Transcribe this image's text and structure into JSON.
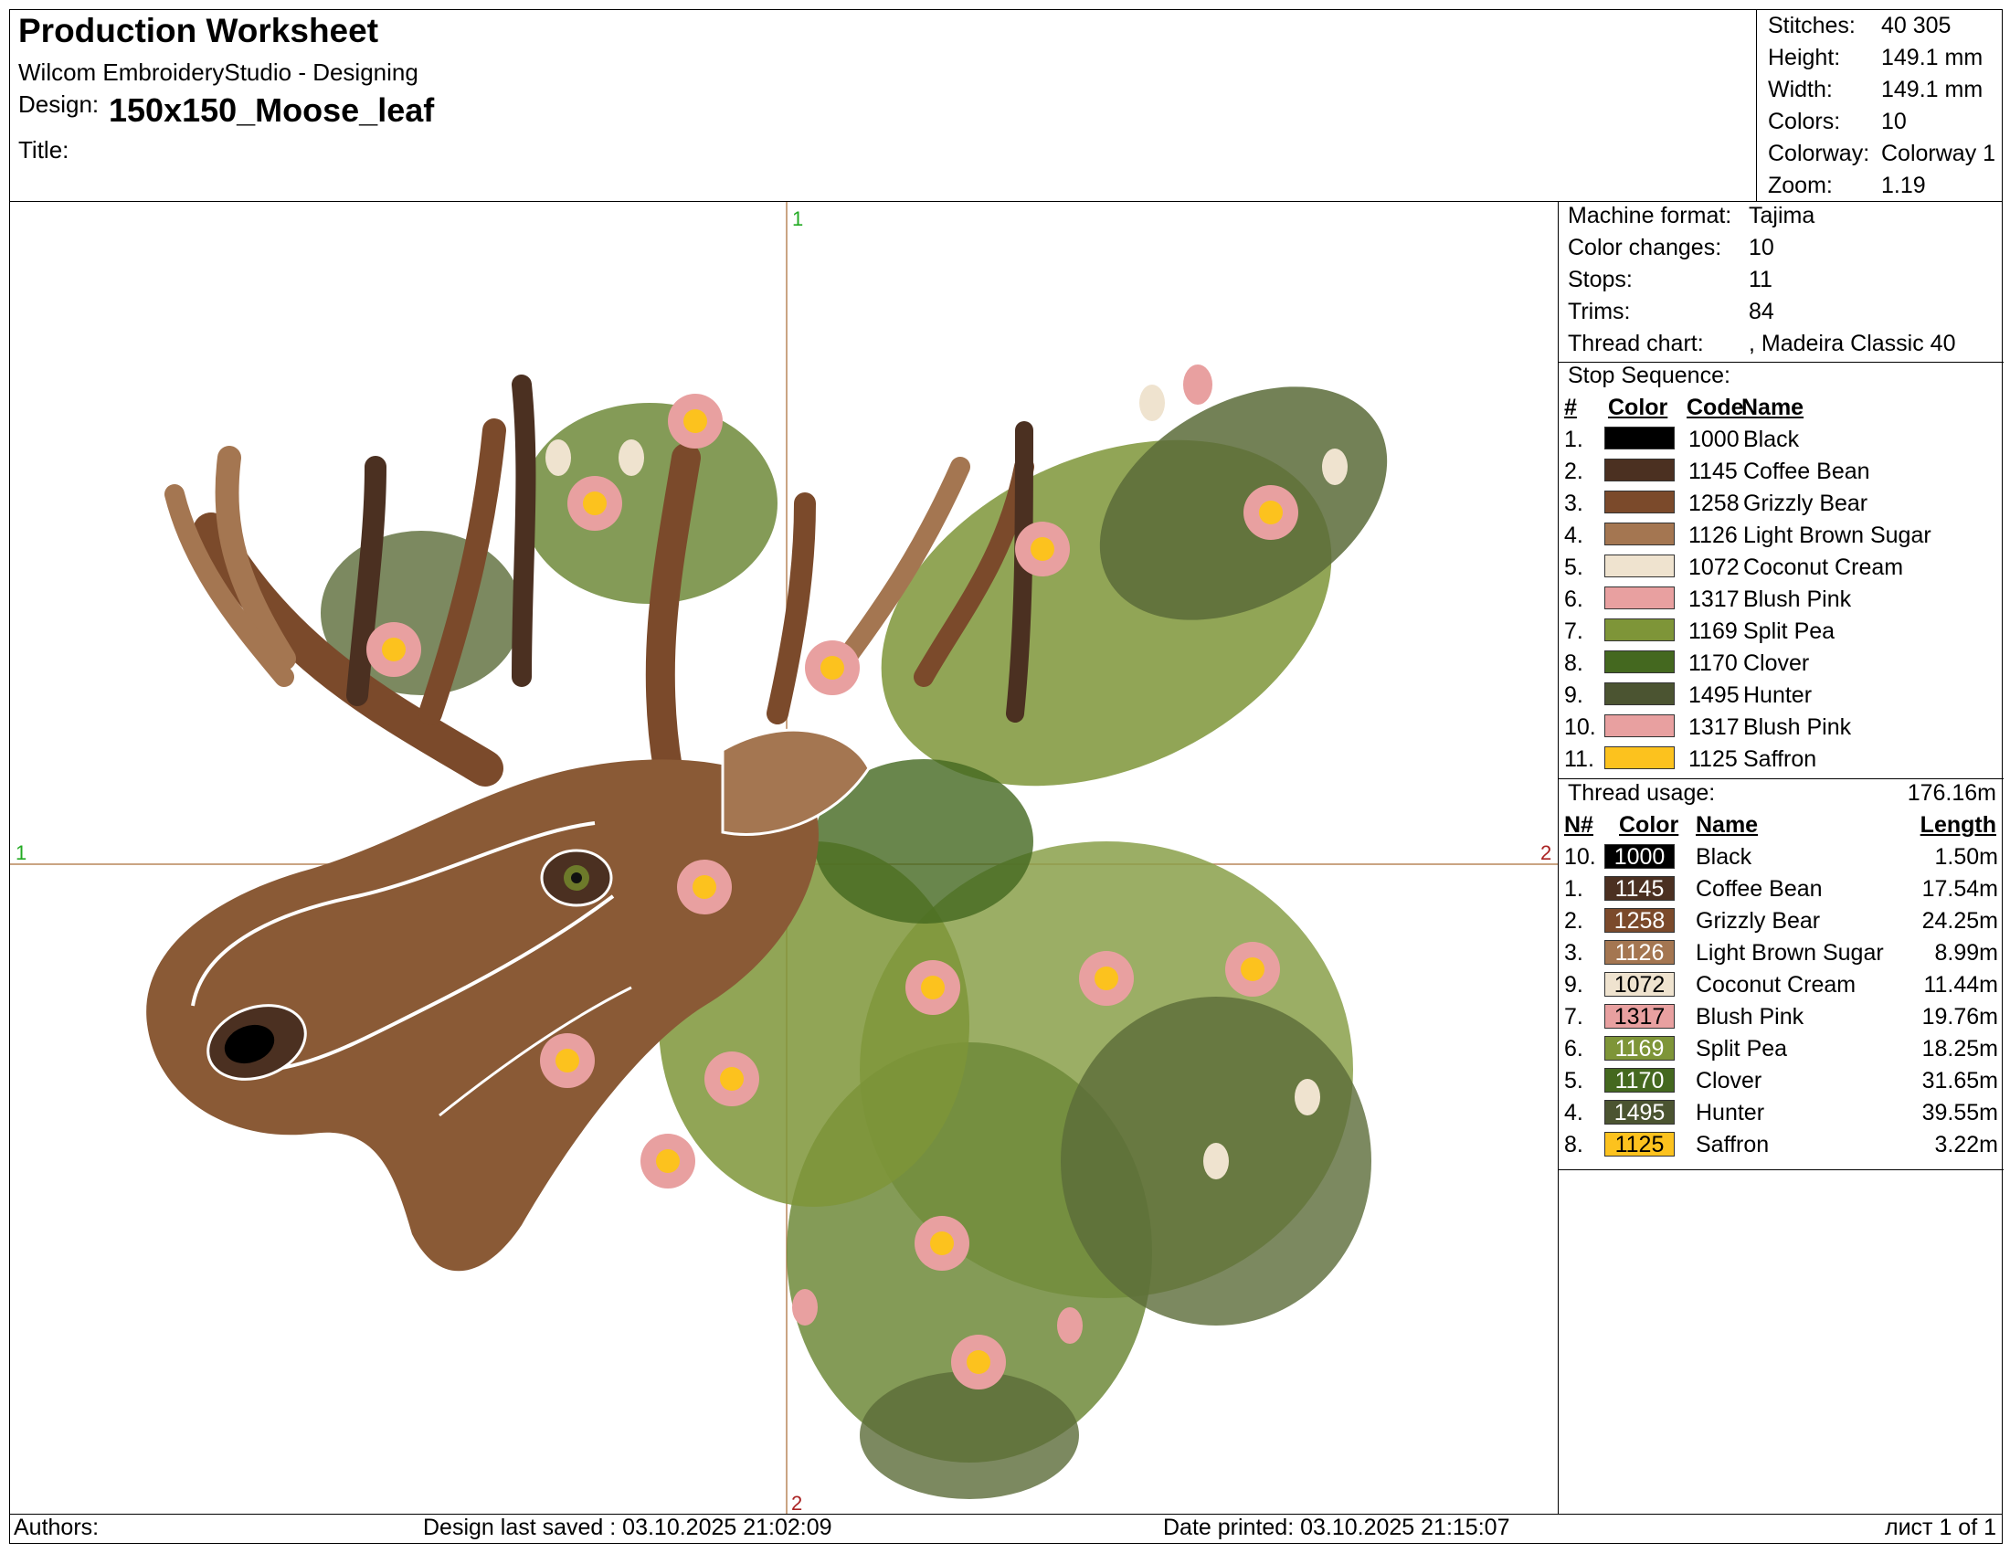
{
  "header": {
    "title": "Production Worksheet",
    "app": "Wilcom EmbroideryStudio - Designing",
    "design_label": "Design:",
    "design_name": "150x150_Moose_leaf",
    "title_label": "Title:"
  },
  "stats": [
    {
      "label": "Stitches:",
      "value": "40 305"
    },
    {
      "label": "Height:",
      "value": "149.1 mm"
    },
    {
      "label": "Width:",
      "value": "149.1 mm"
    },
    {
      "label": "Colors:",
      "value": "10"
    },
    {
      "label": "Colorway:",
      "value": "Colorway 1"
    },
    {
      "label": "Zoom:",
      "value": "1.19"
    }
  ],
  "machine": [
    {
      "label": "Machine format:",
      "value": "Tajima"
    },
    {
      "label": "Color changes:",
      "value": "10"
    },
    {
      "label": "Stops:",
      "value": "11"
    },
    {
      "label": "Trims:",
      "value": "84"
    },
    {
      "label": "Thread chart:",
      "value": ", Madeira Classic 40"
    }
  ],
  "stop_sequence": {
    "title": "Stop Sequence:",
    "headers": {
      "num": "#",
      "color": "Color",
      "code": "Code",
      "name": "Name"
    },
    "rows": [
      {
        "num": "1.",
        "color": "#000000",
        "code": "1000",
        "name": "Black"
      },
      {
        "num": "2.",
        "color": "#4b3021",
        "code": "1145",
        "name": "Coffee Bean"
      },
      {
        "num": "3.",
        "color": "#7b4a2b",
        "code": "1258",
        "name": "Grizzly Bear"
      },
      {
        "num": "4.",
        "color": "#a47651",
        "code": "1126",
        "name": "Light Brown Sugar"
      },
      {
        "num": "5.",
        "color": "#efe3cf",
        "code": "1072",
        "name": "Coconut Cream"
      },
      {
        "num": "6.",
        "color": "#e8a0a0",
        "code": "1317",
        "name": "Blush Pink"
      },
      {
        "num": "7.",
        "color": "#7e9538",
        "code": "1169",
        "name": "Split Pea"
      },
      {
        "num": "8.",
        "color": "#44681f",
        "code": "1170",
        "name": "Clover"
      },
      {
        "num": "9.",
        "color": "#4b5431",
        "code": "1495",
        "name": "Hunter"
      },
      {
        "num": "10.",
        "color": "#e8a0a0",
        "code": "1317",
        "name": "Blush Pink"
      },
      {
        "num": "11.",
        "color": "#fcc21e",
        "code": "1125",
        "name": "Saffron"
      }
    ]
  },
  "thread_usage": {
    "title": "Thread usage:",
    "total": "176.16m",
    "headers": {
      "num": "N#",
      "color": "Color",
      "name": "Name",
      "length": "Length"
    },
    "rows": [
      {
        "num": "10.",
        "color": "#000000",
        "text_color": "#ffffff",
        "code": "1000",
        "name": "Black",
        "length": "1.50m"
      },
      {
        "num": "1.",
        "color": "#4b3021",
        "text_color": "#ffffff",
        "code": "1145",
        "name": "Coffee Bean",
        "length": "17.54m"
      },
      {
        "num": "2.",
        "color": "#7b4a2b",
        "text_color": "#ffffff",
        "code": "1258",
        "name": "Grizzly Bear",
        "length": "24.25m"
      },
      {
        "num": "3.",
        "color": "#a47651",
        "text_color": "#ffffff",
        "code": "1126",
        "name": "Light Brown Sugar",
        "length": "8.99m"
      },
      {
        "num": "9.",
        "color": "#efe3cf",
        "text_color": "#000000",
        "code": "1072",
        "name": "Coconut Cream",
        "length": "11.44m"
      },
      {
        "num": "7.",
        "color": "#e8a0a0",
        "text_color": "#000000",
        "code": "1317",
        "name": "Blush Pink",
        "length": "19.76m"
      },
      {
        "num": "6.",
        "color": "#7e9538",
        "text_color": "#ffffff",
        "code": "1169",
        "name": "Split Pea",
        "length": "18.25m"
      },
      {
        "num": "5.",
        "color": "#44681f",
        "text_color": "#ffffff",
        "code": "1170",
        "name": "Clover",
        "length": "31.65m"
      },
      {
        "num": "4.",
        "color": "#4b5431",
        "text_color": "#ffffff",
        "code": "1495",
        "name": "Hunter",
        "length": "39.55m"
      },
      {
        "num": "8.",
        "color": "#fcc21e",
        "text_color": "#000000",
        "code": "1125",
        "name": "Saffron",
        "length": "3.22m"
      }
    ]
  },
  "canvas": {
    "marker_top": "1",
    "marker_left": "1",
    "marker_right": "2",
    "marker_bottom": "2"
  },
  "footer": {
    "authors": "Authors:",
    "last_saved": "Design last saved : 03.10.2025 21:02:09",
    "printed": "Date printed: 03.10.2025 21:15:07",
    "page": "лист 1 of 1"
  }
}
